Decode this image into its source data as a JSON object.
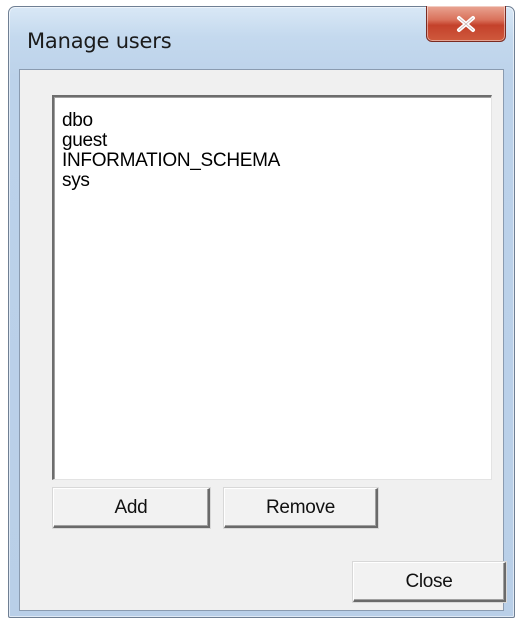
{
  "window": {
    "title": "Manage users",
    "close_icon": "close-x-icon"
  },
  "users_list": {
    "items": [
      "dbo",
      "guest",
      "INFORMATION_SCHEMA",
      "sys"
    ]
  },
  "buttons": {
    "add_label": "Add",
    "remove_label": "Remove",
    "close_label": "Close"
  },
  "colors": {
    "titlebar": "#c4d9ee",
    "close_button": "#c4412b",
    "client_background": "#f0f0f0"
  }
}
